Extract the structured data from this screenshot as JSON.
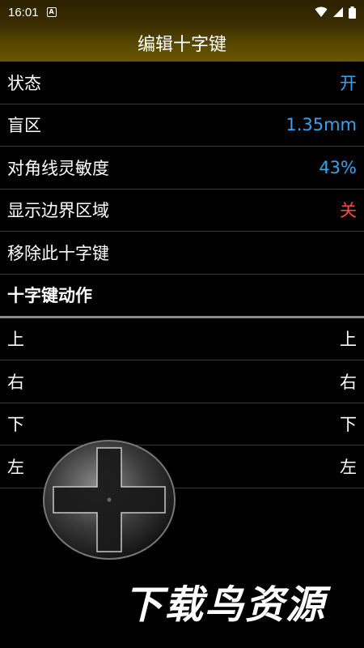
{
  "status_bar": {
    "time": "16:01",
    "notification_letter": "A"
  },
  "app_bar": {
    "title": "编辑十字键"
  },
  "settings": [
    {
      "label": "状态",
      "value": "开",
      "value_color": "blue"
    },
    {
      "label": "盲区",
      "value": "1.35mm",
      "value_color": "blue"
    },
    {
      "label": "对角线灵敏度",
      "value": "43%",
      "value_color": "blue"
    },
    {
      "label": "显示边界区域",
      "value": "关",
      "value_color": "red"
    },
    {
      "label": "移除此十字键",
      "value": ""
    }
  ],
  "section": {
    "title": "十字键动作"
  },
  "actions": [
    {
      "label": "上",
      "value": "上"
    },
    {
      "label": "右",
      "value": "右"
    },
    {
      "label": "下",
      "value": "下"
    },
    {
      "label": "左",
      "value": "左"
    }
  ],
  "watermark": "下载鸟资源",
  "colors": {
    "accent_blue": "#3aa3ef",
    "off_red": "#ff4a4a",
    "app_bar": "#5b4a00"
  }
}
